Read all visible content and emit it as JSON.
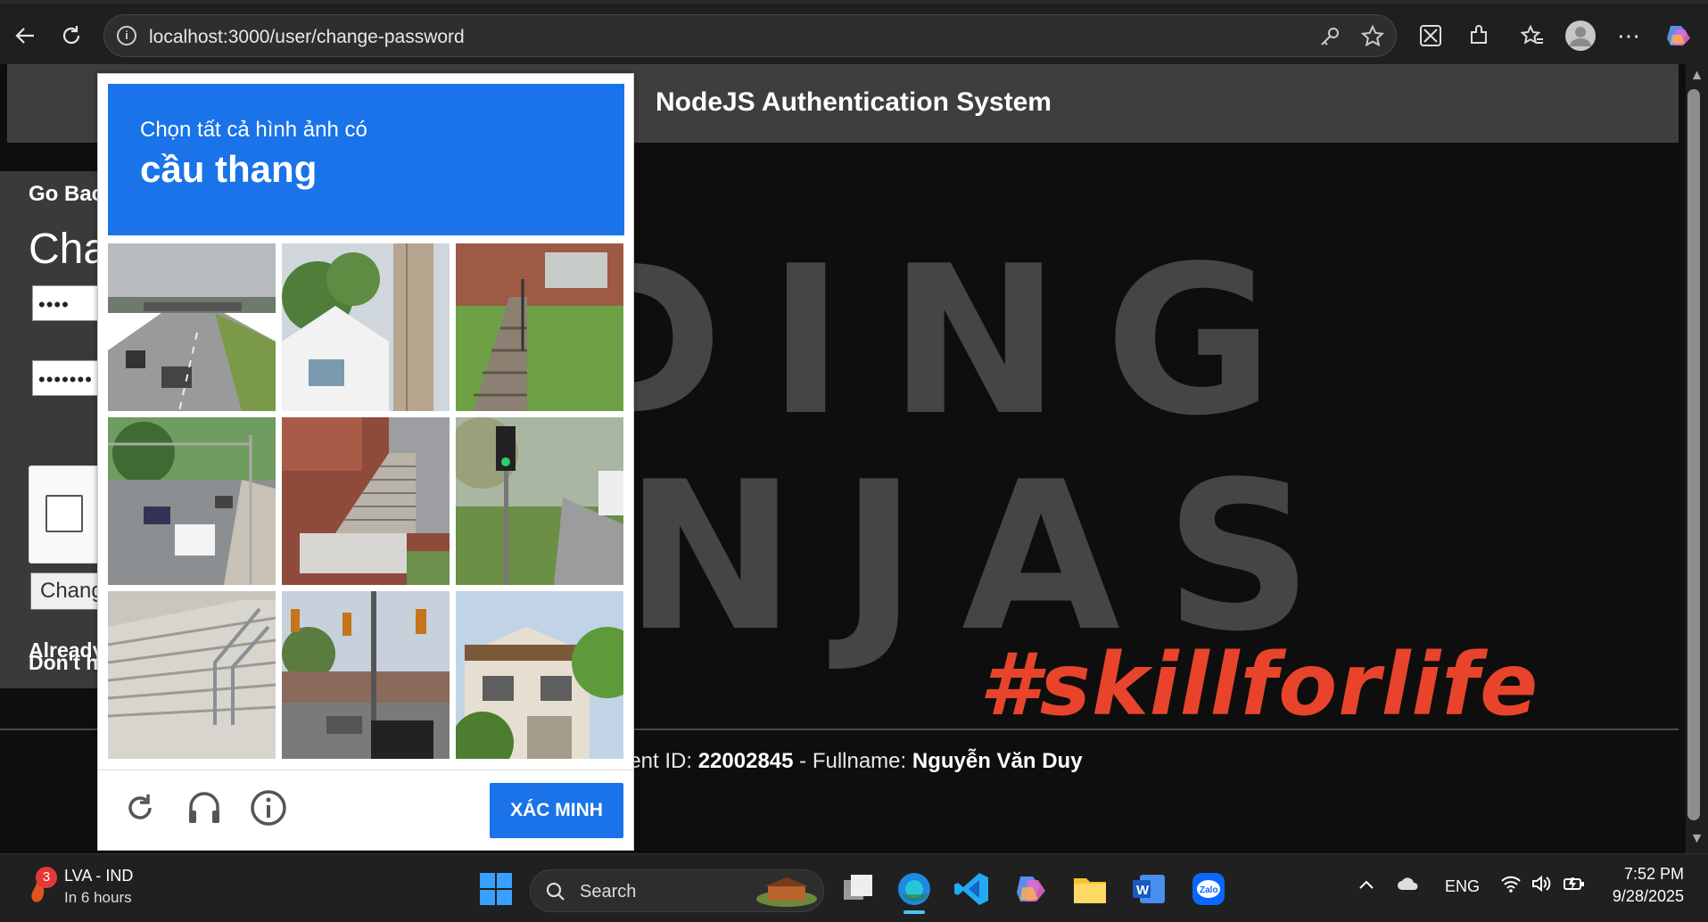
{
  "browser": {
    "url": "localhost:3000/user/change-password"
  },
  "site": {
    "title": "NodeJS Authentication System",
    "hero_line1": "DING",
    "hero_line2": "NJAS",
    "tagline": "#skillforlife",
    "footer_prefix": "lent ID: ",
    "student_id": "22002845",
    "footer_mid": " - Fullname: ",
    "fullname": "Nguyễn Văn Duy"
  },
  "form": {
    "go_back": "Go Back",
    "title": "Change Password",
    "password1_value": "••••",
    "password2_value": "•••••••",
    "submit_label": "Change Password",
    "dont_have": "Don't have an account?",
    "already": "Already have an account?"
  },
  "captcha": {
    "prompt": "Chọn tất cả hình ảnh có",
    "target": "cầu thang",
    "verify_label": "XÁC MINH",
    "tiles": [
      "highway",
      "house-pole",
      "stairs-lawn",
      "road-cars",
      "brick-stairs",
      "traffic-light",
      "concrete-stairs",
      "street-traffic",
      "house-trees"
    ]
  },
  "taskbar": {
    "weather_title": "LVA - IND",
    "weather_sub": "In 6 hours",
    "weather_badge": "3",
    "search_label": "Search",
    "lang": "ENG",
    "time": "7:52 PM",
    "date": "9/28/2025"
  },
  "colors": {
    "captcha_blue": "#1a73e8",
    "tagline": "#e8442c",
    "hero_text": "#454545"
  }
}
